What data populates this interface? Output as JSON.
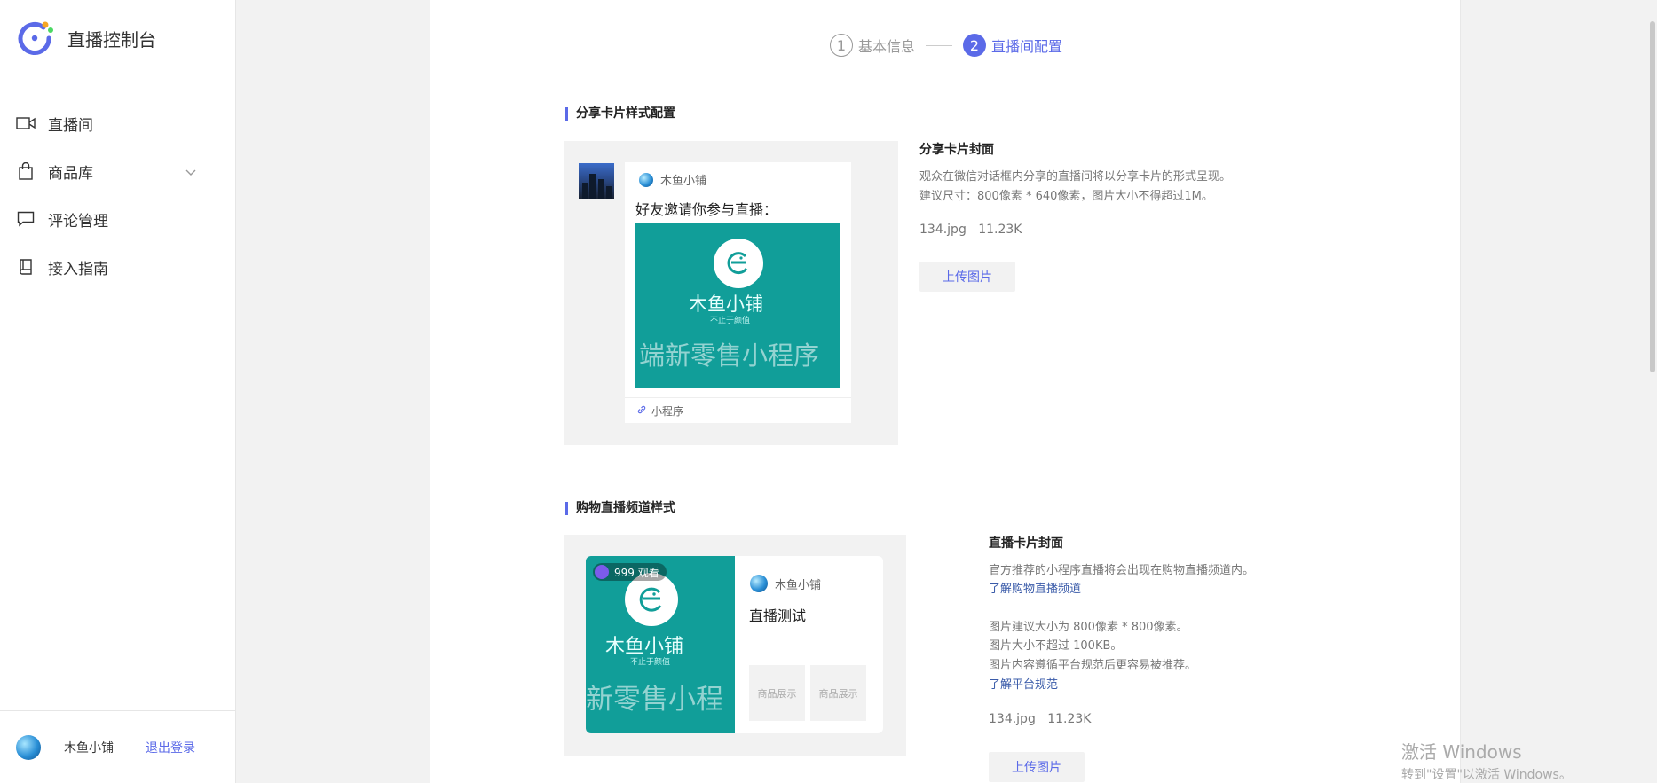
{
  "sidebar": {
    "title": "直播控制台",
    "items": [
      {
        "label": "直播间",
        "icon": "video-camera-icon"
      },
      {
        "label": "商品库",
        "icon": "shopping-bag-icon"
      },
      {
        "label": "评论管理",
        "icon": "comment-icon"
      },
      {
        "label": "接入指南",
        "icon": "book-icon"
      }
    ],
    "user_name": "木鱼小铺",
    "logout_label": "退出登录"
  },
  "steps": [
    {
      "num": "1",
      "label": "基本信息"
    },
    {
      "num": "2",
      "label": "直播间配置"
    }
  ],
  "share_section": {
    "title": "分享卡片样式配置",
    "preview": {
      "shop_name": "木鱼小铺",
      "message": "好友邀请你参与直播：",
      "image_shop": "木鱼小铺",
      "image_tagline": "不止于颜值",
      "image_watermark": "端新零售小程序",
      "footer": "小程序"
    },
    "info": {
      "title": "分享卡片封面",
      "lines": [
        "观众在微信对话框内分享的直播间将以分享卡片的形式呈现。",
        "建议尺寸：800像素 * 640像素，图片大小不得超过1M。"
      ],
      "file_name": "134.jpg",
      "file_size": "11.23K",
      "upload_label": "上传图片"
    }
  },
  "channel_section": {
    "title": "购物直播频道样式",
    "preview": {
      "viewers": "999 观看",
      "shop_name": "木鱼小铺",
      "image_shop": "木鱼小铺",
      "image_tagline": "不止于颜值",
      "image_watermark": "新零售小程",
      "live_title": "直播测试",
      "product_1": "商品展示",
      "product_2": "商品展示"
    },
    "info": {
      "title": "直播卡片封面",
      "line1": "官方推荐的小程序直播将会出现在购物直播频道内。",
      "link1": "了解购物直播频道",
      "line2": "图片建议大小为 800像素 * 800像素。",
      "line3": "图片大小不超过 100KB。",
      "line4": "图片内容遵循平台规范后更容易被推荐。",
      "link2": "了解平台规范",
      "file_name": "134.jpg",
      "file_size": "11.23K",
      "upload_label": "上传图片"
    }
  },
  "windows_watermark": {
    "line1": "激活 Windows",
    "line2": "转到\"设置\"以激活 Windows。"
  },
  "colors": {
    "accent": "#5b6ae8",
    "teal": "#119e99",
    "link": "#3a5ba9"
  }
}
